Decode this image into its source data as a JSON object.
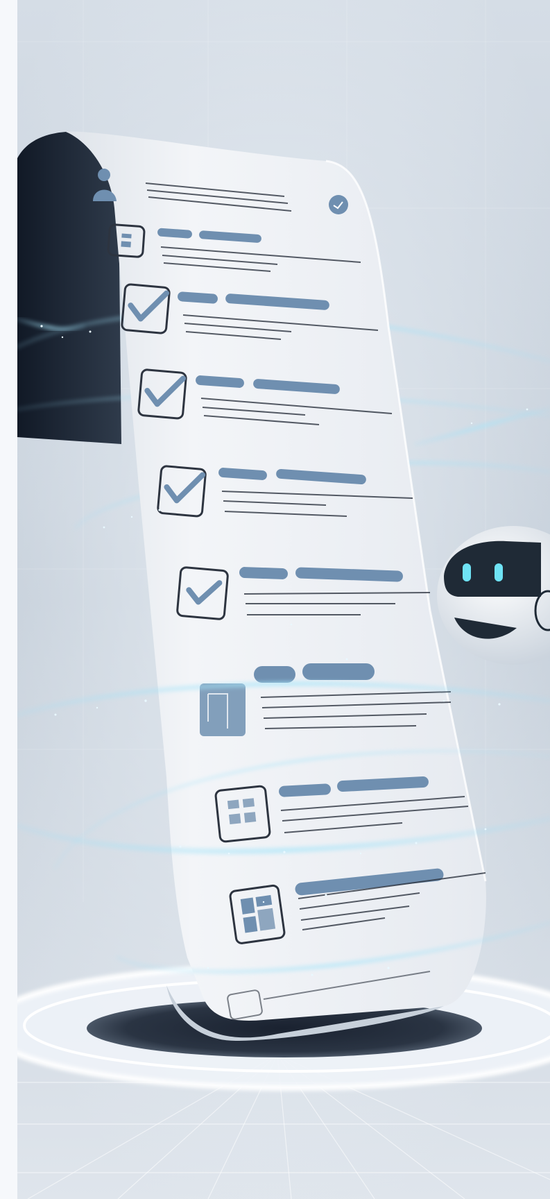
{
  "scene": {
    "subject": "checklist-scroll-with-robot",
    "colors": {
      "background": "#c9d3de",
      "paper": "#eef1f5",
      "paper_shadow": "#1e2836",
      "accent_bar": "#6f8fb0",
      "ink": "#2d3440",
      "swirl": "#8fd3f0",
      "robot_face": "#1f2a36",
      "robot_eye": "#6fe3f5",
      "platform": "#ffffff"
    },
    "checklist": {
      "rows": [
        {
          "icon": "user-icon",
          "status": "header"
        },
        {
          "icon": "document-icon",
          "status": "unchecked"
        },
        {
          "icon": "checkbox-checked-icon",
          "status": "checked"
        },
        {
          "icon": "checkbox-checked-icon",
          "status": "checked"
        },
        {
          "icon": "checkbox-checked-icon",
          "status": "checked"
        },
        {
          "icon": "checkbox-checked-icon",
          "status": "checked"
        },
        {
          "icon": "folder-icon",
          "status": "unchecked"
        },
        {
          "icon": "grid-icon",
          "status": "unchecked"
        },
        {
          "icon": "layout-icon",
          "status": "unchecked"
        }
      ],
      "checked_count": 4
    }
  }
}
